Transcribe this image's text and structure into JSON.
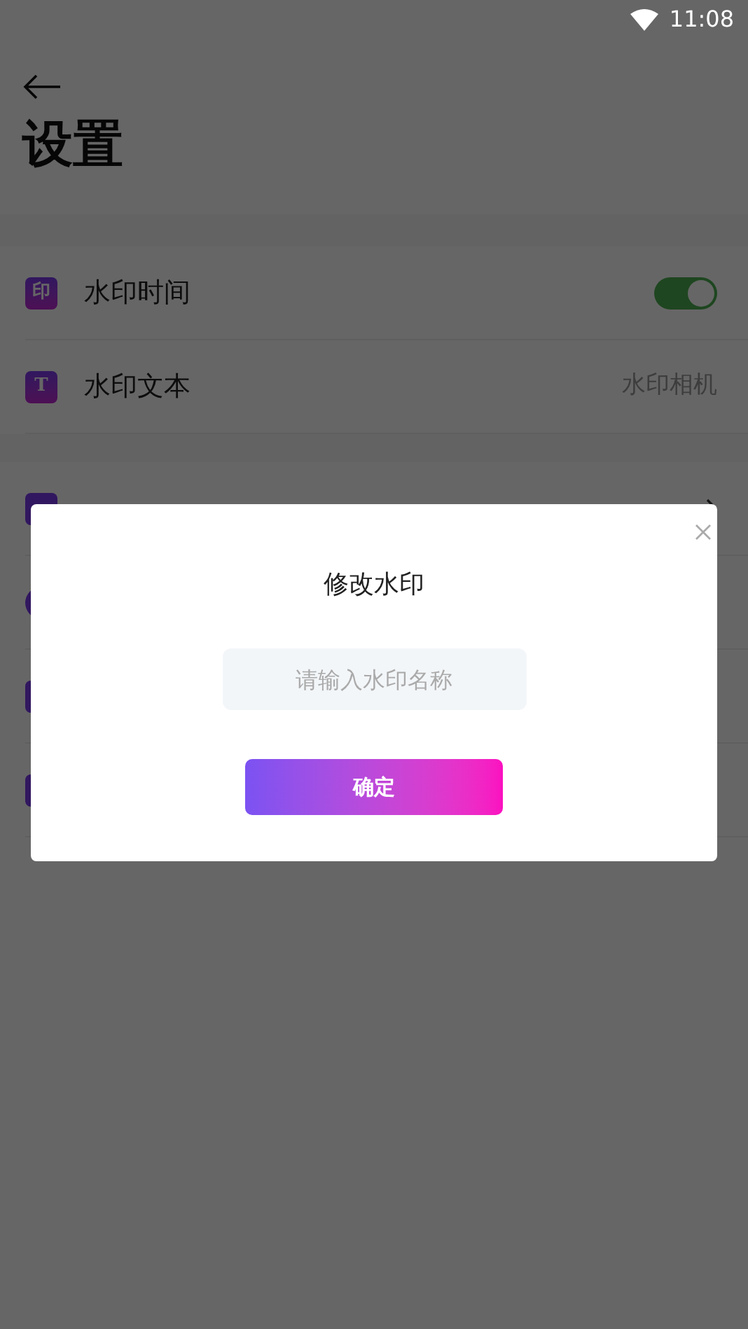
{
  "status_bar": {
    "time": "11:08"
  },
  "header": {
    "title": "设置"
  },
  "settings": [
    {
      "kind": "toggle",
      "icon": "印",
      "label": "水印时间",
      "on": true
    },
    {
      "kind": "value",
      "icon": "T",
      "label": "水印文本",
      "value": "水印相机"
    }
  ],
  "dialog": {
    "title": "修改水印",
    "input": {
      "placeholder": "请输入水印名称"
    },
    "confirm": "确定"
  }
}
